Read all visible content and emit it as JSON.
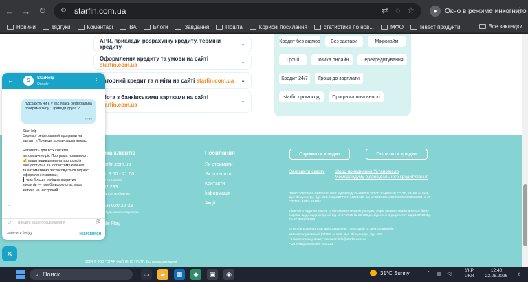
{
  "browser": {
    "url": "starfin.com.ua",
    "incognito_label": "Окно в режиме инкогнито",
    "bookmarks": [
      "Новини",
      "Відгуки",
      "Коментарі",
      "ВА",
      "Блоги",
      "Завдання",
      "Пошта",
      "Корисні посилання",
      "статистика по нов...",
      "МФО",
      "Інвест продукти"
    ],
    "all_bookmarks": "Все закладки"
  },
  "faq": {
    "items": [
      {
        "text": "APR, приклади розрахунку кредиту, терміни кредиту",
        "highlight": ""
      },
      {
        "text": "Оформлення кредиту та умови на сайті ",
        "highlight": "starfin.com.ua"
      },
      {
        "text": "овторний кредит та ліміти на сайті ",
        "highlight": "starfin.com.ua"
      },
      {
        "text": "обота з банківськими картками на сайті",
        "highlight": "starfin.com.ua"
      }
    ]
  },
  "tags": [
    "Кредит без відмов",
    "Без застави",
    "Мікрозайм",
    "Гроші",
    "Позика онлайн",
    "Перекредитування",
    "Кредит 24/7",
    "Гроші до зарплати",
    "starfin промокод",
    "Програма лояльності"
  ],
  "footer": {
    "col1_title": "ика клієнтів",
    "col1_lines": [
      "tarfin.com.ua",
      "н: 9:00 - 21:00",
      "ні по Україні",
      "02 233",
      "на для мобільних",
      "63) 020 22 33",
      "з будь-якого оператора",
      "gle Play"
    ],
    "col2_title": "Посилання",
    "col2_links": [
      "Як отримати",
      "Як погасити",
      "Контакти",
      "Інформація",
      "Акції"
    ],
    "btn_get": "Отримати кредит",
    "btn_pay": "Оплатити кредит",
    "complaint": "Залишити скаргу",
    "belonging_line1": "Шодо приєднання Установи до",
    "belonging_line2": "Меморандуму відповідального кредитування",
    "company_info": "ТОВАРИСТВО З ОБМЕЖЕНОЮ ВІДПОВІДАЛЬНІСТЮ \"СТАР ФАЙНЕНС ГРУП\", 03150, м. Київ, вул. Фізкультури, буд. 30В. Код ЄДРПОУ 44023410, р/р UA643348510000000026005023394, в АТ \"ПУМБ\", МФО 334851",
    "license_info": "Ліцензія з надання коштів та банківських металів у кредит, згідно рішення Національного банку України щодо видачі ліцензії від 10.07.2025 № 25/798-рк, віднесення до реєстру від 21.07.2025р. № 27-0026/98036",
    "complaints_title": "Способи розгляду Компанією звернень, пропозицій та заяв споживачів:",
    "complaint_ways": [
      "На адресу Компанії (03150, м. Київ, вул. Фізкультури, буд. 30В",
      "На електронну пошту Компанії: info@starfin.com.ua",
      "За телефоном 0800 202 233"
    ],
    "copyright": "2024 © ТОВ \"СТАР ФАЙНЕНС ГРУП\". Всі права захищені"
  },
  "chat": {
    "name": "StarHelp",
    "status": "Онлайн",
    "user_message": "підскажіть чи є у вас якась реферальна програма типу \"Приведи друга\"?",
    "user_time": "12:37",
    "agent_name": "StarHelp",
    "agent_message": "Окремої реферальної програми на кшталт «Приведи друга» зараз немає.\n\nНатомість для всіх клієнтів автоматично діє Програма лояльності:\n💰 ваша індивідуальна пропозиція вже доступна в Особистому кабінеті та автоматично застосовується під час оформлення заявки;\n▌ чим більше успішно закритих кредитів — тим більшою стає ваша знижка на наступний",
    "placeholder": "Введіть ваше повідомлення",
    "end_chat": "Закінчити бесіду",
    "brand": "HELPCRUNCH"
  },
  "taskbar": {
    "search": "Поиск",
    "weather": "31°C  Sunny",
    "lang1": "УКР",
    "lang2": "UKR",
    "time": "12:40",
    "date": "22.08.2026"
  }
}
